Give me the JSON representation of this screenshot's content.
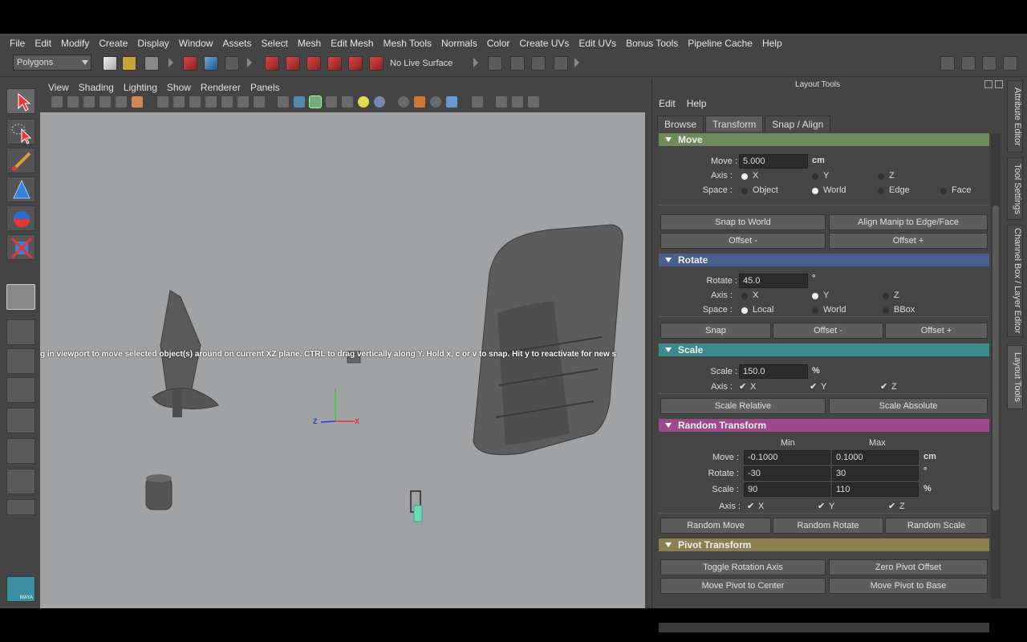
{
  "menubar": [
    "File",
    "Edit",
    "Modify",
    "Create",
    "Display",
    "Window",
    "Assets",
    "Select",
    "Mesh",
    "Edit Mesh",
    "Mesh Tools",
    "Normals",
    "Color",
    "Create UVs",
    "Edit UVs",
    "Bonus Tools",
    "Pipeline Cache",
    "Help"
  ],
  "status_line": {
    "mode": "Polygons",
    "live_surface": "No Live Surface"
  },
  "viewport": {
    "menu": [
      "View",
      "Shading",
      "Lighting",
      "Show",
      "Renderer",
      "Panels"
    ],
    "hud_message": "g in viewport to move selected object(s) around on current XZ plane.  CTRL to drag vertically along Y.  Hold x, c or v to snap.  Hit y to reactivate for new s",
    "axis": {
      "x": "X",
      "z": "Z"
    }
  },
  "panel": {
    "title": "Layout Tools",
    "menu": [
      "Edit",
      "Help"
    ],
    "tabs": [
      "Browse",
      "Transform",
      "Snap / Align"
    ],
    "active_tab": "Transform",
    "move": {
      "header": "Move",
      "label": "Move :",
      "value": "5.000",
      "unit": "cm",
      "axis_label": "Axis :",
      "axis_options": [
        "X",
        "Y",
        "Z"
      ],
      "space_label": "Space :",
      "space_options": [
        "Object",
        "World",
        "Edge",
        "Face"
      ],
      "buttons": [
        "Snap to World",
        "Align Manip to Edge/Face",
        "Offset -",
        "Offset +"
      ]
    },
    "rotate": {
      "header": "Rotate",
      "label": "Rotate :",
      "value": "45.0",
      "unit": "°",
      "axis_label": "Axis :",
      "axis_options": [
        "X",
        "Y",
        "Z"
      ],
      "space_label": "Space :",
      "space_options": [
        "Local",
        "World",
        "BBox"
      ],
      "buttons": [
        "Snap",
        "Offset -",
        "Offset +"
      ]
    },
    "scale": {
      "header": "Scale",
      "label": "Scale :",
      "value": "150.0",
      "unit": "%",
      "axis_label": "Axis :",
      "axis_options": [
        "X",
        "Y",
        "Z"
      ],
      "buttons": [
        "Scale Relative",
        "Scale Absolute"
      ]
    },
    "random": {
      "header": "Random Transform",
      "min_label": "Min",
      "max_label": "Max",
      "move_label": "Move :",
      "move_min": "-0.1000",
      "move_max": "0.1000",
      "move_unit": "cm",
      "rotate_label": "Rotate :",
      "rotate_min": "-30",
      "rotate_max": "30",
      "rotate_unit": "°",
      "scale_label": "Scale :",
      "scale_min": "90",
      "scale_max": "110",
      "scale_unit": "%",
      "axis_label": "Axis :",
      "axis_options": [
        "X",
        "Y",
        "Z"
      ],
      "buttons": [
        "Random Move",
        "Random Rotate",
        "Random Scale"
      ]
    },
    "pivot": {
      "header": "Pivot Transform",
      "buttons": [
        "Toggle Rotation Axis",
        "Zero Pivot Offset",
        "Move Pivot to Center",
        "Move Pivot to Base"
      ]
    }
  },
  "side_tabs": [
    "Attribute Editor",
    "Tool Settings",
    "Channel Box / Layer Editor",
    "Layout Tools"
  ],
  "colors": {
    "move_header": "#6f8a5a",
    "rotate_header": "#4a5f8c",
    "scale_header": "#3d8a8c",
    "random_header": "#9c4a8c",
    "pivot_header": "#8c7f52",
    "viewport_bg": "#a0a2a4"
  },
  "check_mark": "✔",
  "maya_logo": "MAYA"
}
